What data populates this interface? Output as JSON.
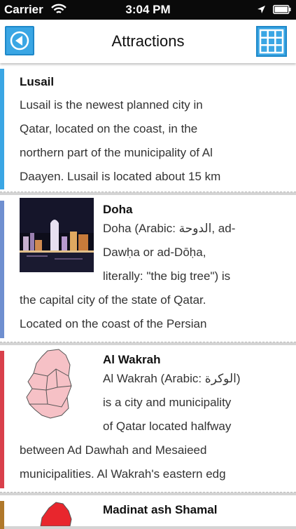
{
  "status_bar": {
    "carrier": "Carrier",
    "time": "3:04 PM"
  },
  "nav": {
    "title": "Attractions",
    "back_icon": "back-arrow-icon",
    "grid_icon": "grid-icon"
  },
  "colors": {
    "accent_blue": "#3aa6e4",
    "accent_lusail": "#3aa6e4",
    "accent_doha": "#6f8fd0",
    "accent_wakrah": "#d9404b",
    "accent_shamal": "#b0782a"
  },
  "attractions": [
    {
      "name": "Lusail",
      "lines": [
        "Lusail is the newest planned city in",
        "Qatar, located on the coast, in the",
        "northern part of the municipality of Al",
        "Daayen. Lusail is located about 15 km"
      ]
    },
    {
      "name": "Doha",
      "lines": [
        "Doha (Arabic: الدوحة, ad-",
        "Dawḥa or ad-Dōḥa,",
        "literally: \"the big tree\") is",
        "the capital city of the state of Qatar.",
        "Located on the coast of the Persian"
      ]
    },
    {
      "name": "Al Wakrah",
      "lines": [
        "Al Wakrah (Arabic: الوكرة)",
        "is a city and municipality",
        "of Qatar located halfway",
        "between Ad Dawhah and Mesaieed",
        "municipalities. Al Wakrah's eastern edg"
      ]
    },
    {
      "name": "Madinat ash Shamal"
    }
  ]
}
